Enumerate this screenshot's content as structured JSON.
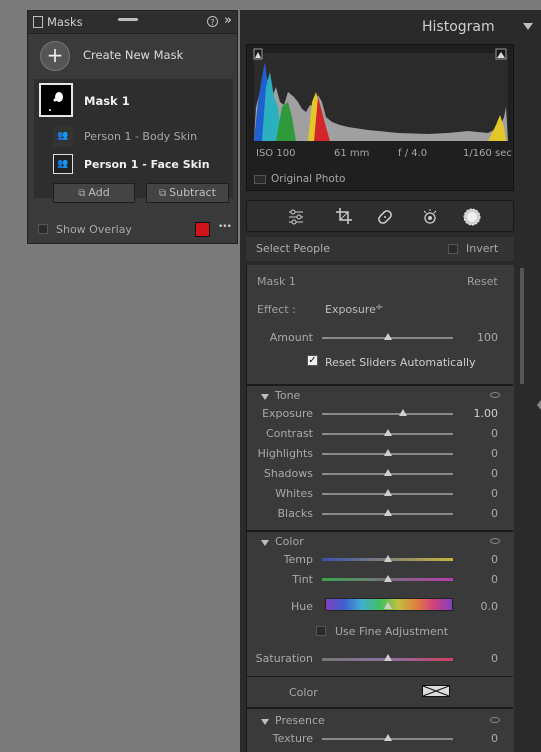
{
  "masks_panel": {
    "title": "Masks",
    "help": "?",
    "collapse": "»",
    "create_label": "Create New Mask",
    "mask_name": "Mask 1",
    "components": [
      {
        "label": "Person 1 - Body Skin",
        "active": false
      },
      {
        "label": "Person 1 - Face Skin",
        "active": true
      }
    ],
    "add_label": "Add",
    "subtract_label": "Subtract",
    "show_overlay_label": "Show Overlay",
    "overlay_color": "#d0141a",
    "more": "•••"
  },
  "histogram": {
    "title": "Histogram",
    "iso": "ISO 100",
    "focal": "61 mm",
    "aperture": "f / 4.0",
    "shutter": "1/160 sec",
    "original_photo_label": "Original Photo"
  },
  "tools": [
    "edit-sliders-icon",
    "crop-icon",
    "healing-icon",
    "redeye-icon",
    "masking-icon"
  ],
  "select_people": {
    "label": "Select People",
    "invert_label": "Invert"
  },
  "mask_settings": {
    "mask_label": "Mask 1",
    "reset_label": "Reset",
    "effect_label": "Effect :",
    "effect_value": "Exposure",
    "effect_arrows": "÷",
    "amount_label": "Amount",
    "amount_value": "100",
    "reset_sliders_label": "Reset Sliders Automatically"
  },
  "tone": {
    "title": "Tone",
    "sliders": [
      {
        "label": "Exposure",
        "value": "1.00"
      },
      {
        "label": "Contrast",
        "value": "0"
      },
      {
        "label": "Highlights",
        "value": "0"
      },
      {
        "label": "Shadows",
        "value": "0"
      },
      {
        "label": "Whites",
        "value": "0"
      },
      {
        "label": "Blacks",
        "value": "0"
      }
    ]
  },
  "color": {
    "title": "Color",
    "temp_label": "Temp",
    "temp_value": "0",
    "tint_label": "Tint",
    "tint_value": "0",
    "hue_label": "Hue",
    "hue_value": "0.0",
    "fine_adjust_label": "Use Fine Adjustment",
    "saturation_label": "Saturation",
    "saturation_value": "0",
    "color_label": "Color"
  },
  "presence": {
    "title": "Presence",
    "texture_label": "Texture",
    "texture_value": "0"
  }
}
